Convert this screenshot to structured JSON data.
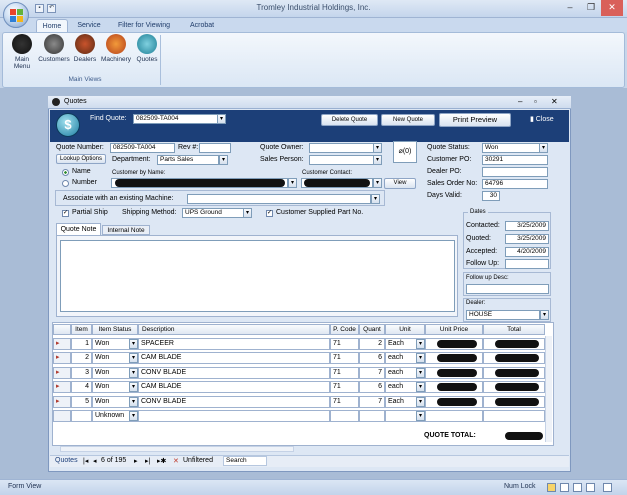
{
  "app": {
    "title": "Tromley Industrial Holdings, Inc.",
    "tabs": [
      "Home",
      "Service",
      "Filter for Viewing",
      "Acrobat"
    ],
    "ribbon_buttons": [
      {
        "label": "Main Menu",
        "icon": "main-menu-icon"
      },
      {
        "label": "Customers",
        "icon": "customers-icon"
      },
      {
        "label": "Dealers",
        "icon": "dealers-icon"
      },
      {
        "label": "Machinery",
        "icon": "machinery-icon"
      },
      {
        "label": "Quotes",
        "icon": "quotes-icon"
      }
    ],
    "group_label": "Main Views",
    "status_left": "Form View",
    "status_right": "Num Lock"
  },
  "form": {
    "window_title": "Quotes",
    "find_quote_label": "Find Quote:",
    "find_quote_value": "082509-TA004",
    "delete_label": "Delete Quote",
    "new_label": "New Quote",
    "print_label": "Print Preview",
    "close_label": "Close",
    "quote_number_label": "Quote Number:",
    "quote_number_value": "082509-TA004",
    "rev_label": "Rev #:",
    "lookup_label": "Lookup Options",
    "department_label": "Department:",
    "department_value": "Parts Sales",
    "quote_owner_label": "Quote Owner:",
    "sales_person_label": "Sales Person:",
    "attach_label": "(0)",
    "radio_name": "Name",
    "radio_number": "Number",
    "customer_by_name_label": "Customer by Name:",
    "customer_contact_label": "Customer Contact:",
    "view_label": "View",
    "associate_label": "Associate with an existing Machine:",
    "partial_ship_label": "Partial Ship",
    "shipping_method_label": "Shipping Method:",
    "shipping_method_value": "UPS Ground",
    "customer_supplied_label": "Customer Supplied Part No.",
    "quote_note_tab": "Quote Note",
    "internal_note_tab": "Internal Note",
    "quote_status_label": "Quote Status:",
    "quote_status_value": "Won",
    "customer_po_label": "Customer PO:",
    "customer_po_value": "30291",
    "dealer_po_label": "Dealer PO:",
    "sales_order_label": "Sales Order No:",
    "sales_order_value": "64796",
    "days_valid_label": "Days Valid:",
    "days_valid_value": "30",
    "dates_label": "Dates",
    "contacted_label": "Contacted:",
    "contacted_value": "3/25/2009",
    "quoted_label": "Quoted:",
    "quoted_value": "3/25/2009",
    "accepted_label": "Accepted:",
    "accepted_value": "4/20/2009",
    "follow_up_label": "Follow Up:",
    "follow_up_desc_label": "Follow up Desc:",
    "dealer_label": "Dealer:",
    "dealer_value": "HOUSE",
    "quote_total_label": "QUOTE TOTAL:",
    "nav_label": "Quotes",
    "nav_record": "6 of 195",
    "nav_filter": "Unfiltered",
    "nav_search": "Search"
  },
  "lines": {
    "headers": [
      "Item",
      "Item Status",
      "Description",
      "P. Code",
      "Quant",
      "Unit",
      "Unit Price",
      "Total"
    ],
    "rows": [
      {
        "item": "1",
        "status": "Won",
        "desc": "SPACEER",
        "pcode": "71",
        "qty": "2",
        "unit": "Each"
      },
      {
        "item": "2",
        "status": "Won",
        "desc": "CAM BLADE",
        "pcode": "71",
        "qty": "6",
        "unit": "each"
      },
      {
        "item": "3",
        "status": "Won",
        "desc": "CONV BLADE",
        "pcode": "71",
        "qty": "7",
        "unit": "each"
      },
      {
        "item": "4",
        "status": "Won",
        "desc": "CAM BLADE",
        "pcode": "71",
        "qty": "6",
        "unit": "each"
      },
      {
        "item": "5",
        "status": "Won",
        "desc": "CONV BLADE",
        "pcode": "71",
        "qty": "7",
        "unit": "Each"
      }
    ],
    "new_row_status": "Unknown"
  }
}
